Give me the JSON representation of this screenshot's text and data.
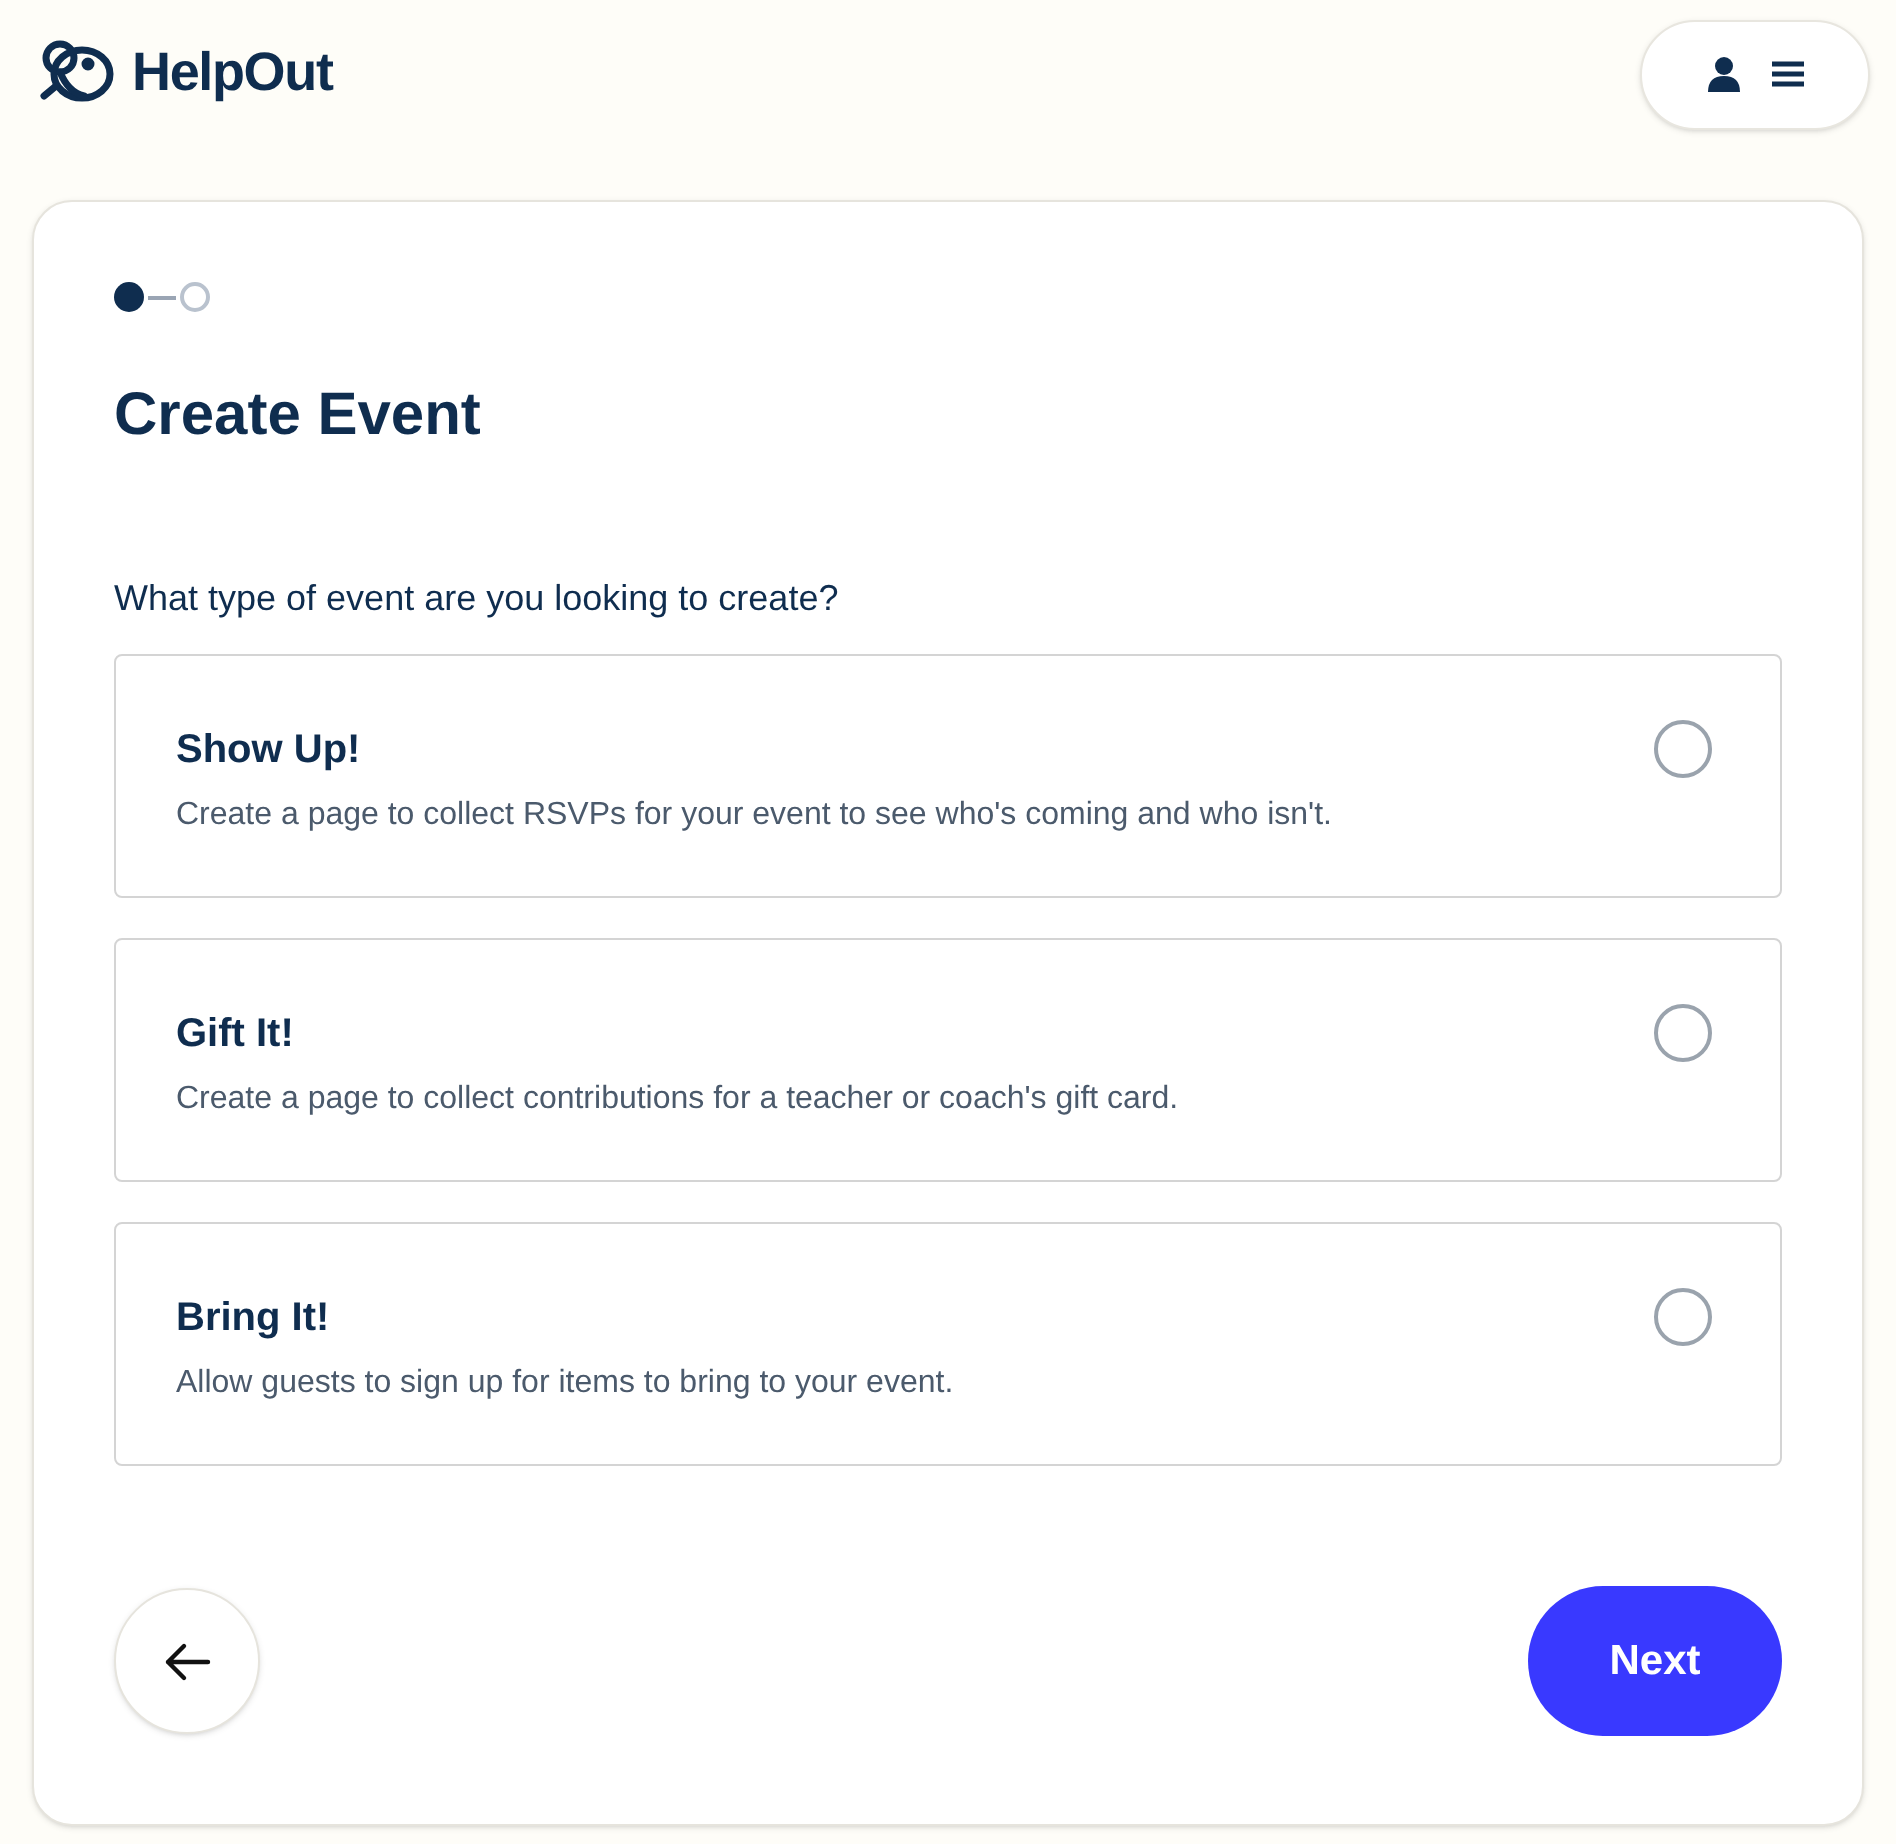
{
  "brand": {
    "name": "HelpOut"
  },
  "steps": [
    {
      "selected": true
    },
    {
      "selected": false
    }
  ],
  "title": "Create Event",
  "question": "What type of event are you looking to create?",
  "options": [
    {
      "title": "Show Up!",
      "description": "Create a page to collect RSVPs for your event to see who's coming and who isn't.",
      "selected": false
    },
    {
      "title": "Gift It!",
      "description": "Create a page to collect contributions for a teacher or coach's gift card.",
      "selected": false
    },
    {
      "title": "Bring It!",
      "description": "Allow guests to sign up for items to bring to your event.",
      "selected": false
    }
  ],
  "next_button": "Next"
}
